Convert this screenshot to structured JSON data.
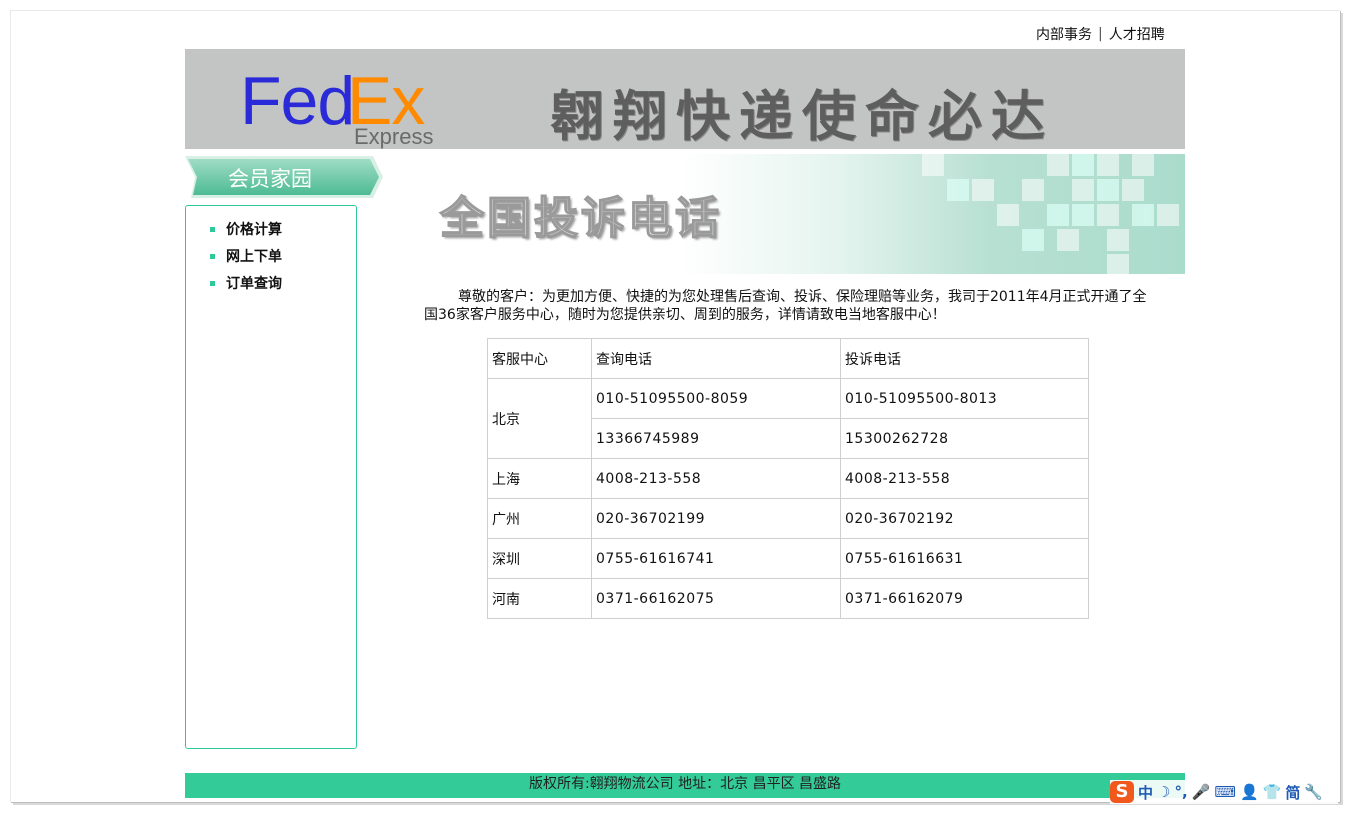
{
  "top_links": {
    "internal": "内部事务",
    "separator": "|",
    "careers": "人才招聘"
  },
  "banner": {
    "logo": {
      "fed": "Fed",
      "ex": "Ex",
      "sub": "Express"
    },
    "slogan": "翱翔快递使命必达"
  },
  "sidebar": {
    "title": "会员家园",
    "items": [
      {
        "label": "价格计算"
      },
      {
        "label": "网上下单"
      },
      {
        "label": "订单查询"
      }
    ]
  },
  "hero": {
    "title": "全国投诉电话"
  },
  "intro": "尊敬的客户：为更加方便、快捷的为您处理售后查询、投诉、保险理赔等业务，我司于2011年4月正式开通了全国36家客户服务中心，随时为您提供亲切、周到的服务，详情请致电当地客服中心！",
  "table": {
    "headers": [
      "客服中心",
      "查询电话",
      "投诉电话"
    ],
    "rows": [
      {
        "city": "北京",
        "inquiry": "010-51095500-8059",
        "complaint": "010-51095500-8013"
      },
      {
        "city": "",
        "inquiry": "13366745989",
        "complaint": "15300262728"
      },
      {
        "city": "上海",
        "inquiry": "4008-213-558",
        "complaint": "4008-213-558"
      },
      {
        "city": "广州",
        "inquiry": "020-36702199",
        "complaint": "020-36702192"
      },
      {
        "city": "深圳",
        "inquiry": "0755-61616741",
        "complaint": "0755-61616631"
      },
      {
        "city": "河南",
        "inquiry": "0371-66162075",
        "complaint": "0371-66162079"
      }
    ]
  },
  "footer": "版权所有:翱翔物流公司 地址：北京 昌平区 昌盛路",
  "ime": {
    "logo": "S",
    "mode": "中",
    "moon": "☽",
    "punct": "°,",
    "mic": "🎤",
    "keyboard": "⌨",
    "user": "👤",
    "skin": "👕",
    "simp": "简",
    "tools": "🔧"
  },
  "colors": {
    "accent": "#33cc99",
    "banner_bg": "#c2c5c3",
    "fed": "#2a2ad8",
    "ex": "#ff8a00"
  }
}
